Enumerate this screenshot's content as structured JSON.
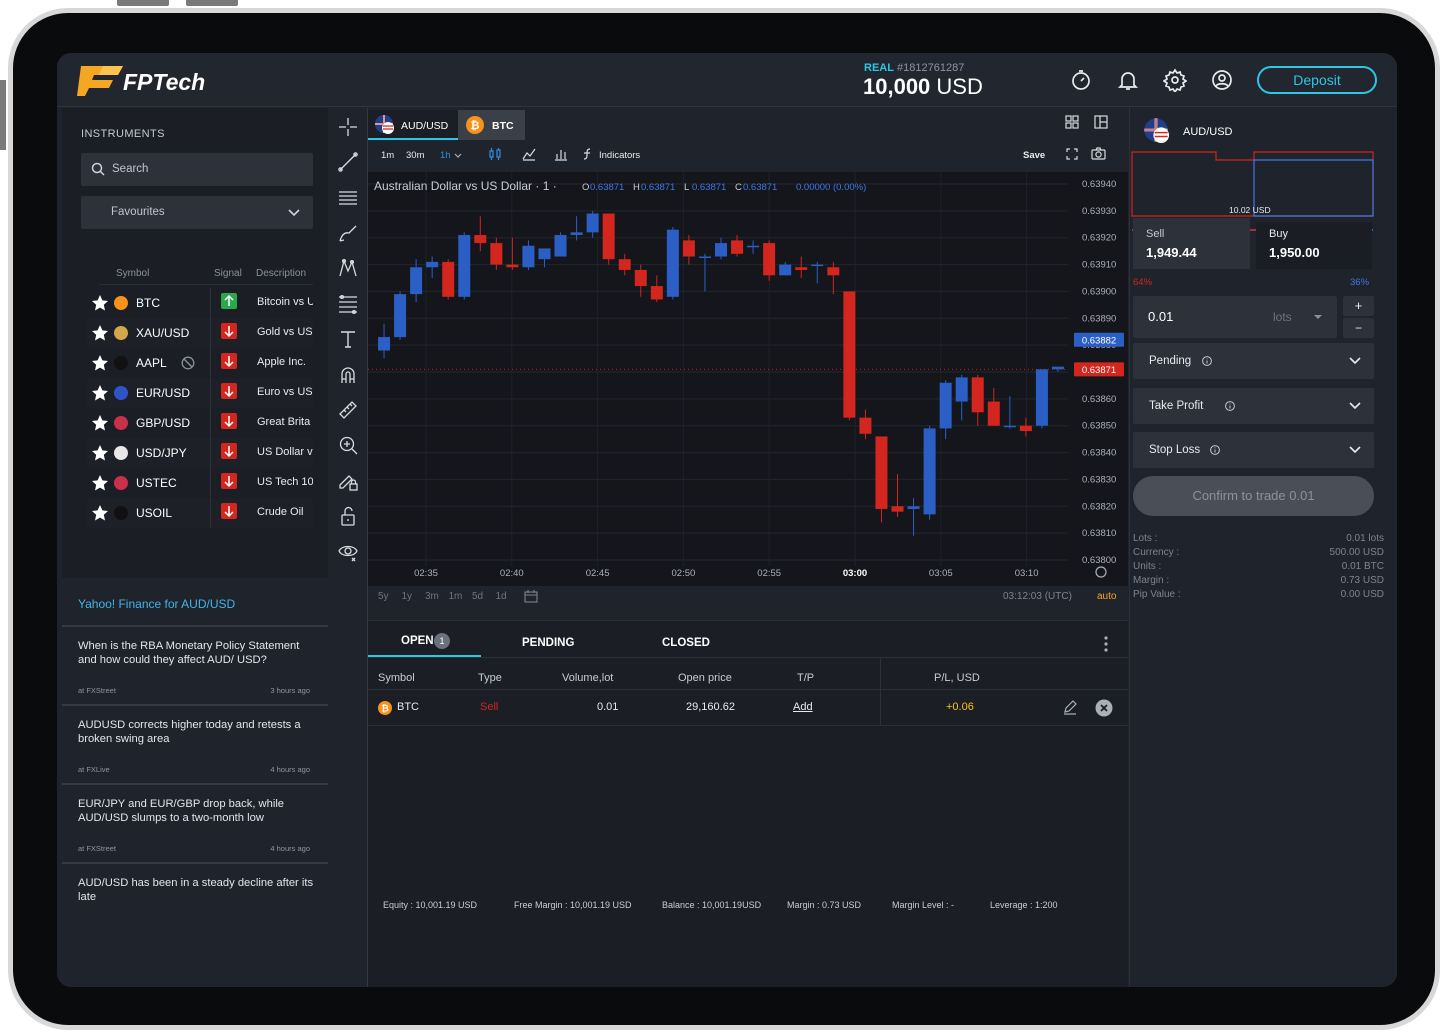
{
  "brand": {
    "logo_letter": "F",
    "name": "FPTech"
  },
  "account": {
    "type": "REAL",
    "number": "#1812761287",
    "balance": "10,000",
    "currency": "USD"
  },
  "topbar": {
    "deposit_label": "Deposit"
  },
  "instruments": {
    "title": "INSTRUMENTS",
    "search_placeholder": "Search",
    "filter": "Favourites",
    "columns": {
      "symbol": "Symbol",
      "signal": "Signal",
      "description": "Description"
    },
    "rows": [
      {
        "symbol": "BTC",
        "signal": "up",
        "description": "Bitcoin vs U",
        "coin_color": "#f7931a"
      },
      {
        "symbol": "XAU/USD",
        "signal": "down",
        "description": "Gold vs US",
        "coin_color": "#d4a84a"
      },
      {
        "symbol": "AAPL",
        "signal": "down",
        "description": "Apple Inc.",
        "coin_color": "#111111"
      },
      {
        "symbol": "EUR/USD",
        "signal": "down",
        "description": "Euro vs US",
        "coin_color": "#2e55c8"
      },
      {
        "symbol": "GBP/USD",
        "signal": "down",
        "description": "Great Brita",
        "coin_color": "#c9304a"
      },
      {
        "symbol": "USD/JPY",
        "signal": "down",
        "description": "US Dollar v",
        "coin_color": "#e8e8e8"
      },
      {
        "symbol": "USTEC",
        "signal": "down",
        "description": "US Tech 10",
        "coin_color": "#c9304a"
      },
      {
        "symbol": "USOIL",
        "signal": "down",
        "description": "Crude Oil",
        "coin_color": "#111111"
      }
    ]
  },
  "news": {
    "title": "Yahoo! Finance for AUD/USD",
    "items": [
      {
        "text": "When is the RBA Monetary Policy Statement and how could they affect AUD/ USD?",
        "source": "at FXStreet",
        "ago": "3 hours ago"
      },
      {
        "text": "AUDUSD corrects higher today and retests a broken swing area",
        "source": "at FXLive",
        "ago": "4 hours ago"
      },
      {
        "text": "EUR/JPY and EUR/GBP drop back, while AUD/USD slumps to a two-month low",
        "source": "at FXStreet",
        "ago": "4 hours ago"
      },
      {
        "text": "AUD/USD has been in a steady decline after its late",
        "source": "",
        "ago": ""
      }
    ]
  },
  "chart_tabs": [
    {
      "label": "AUD/USD"
    },
    {
      "label": "BTC"
    }
  ],
  "chart_toolbar": {
    "intervals": [
      "1m",
      "30m",
      "1h"
    ],
    "indicators_label": "Indicators",
    "save_label": "Save"
  },
  "chart_footer": {
    "ranges": [
      "5y",
      "1y",
      "3m",
      "1m",
      "5d",
      "1d"
    ],
    "clock": "03:12:03 (UTC)",
    "auto_label": "auto"
  },
  "chart_data": {
    "type": "candlestick",
    "title": "Australian Dollar vs US Dollar · 1 ·",
    "ohlc_readout": {
      "O": "0.63871",
      "H": "0.63871",
      "L": "0.63871",
      "C": "0.63871",
      "change": "0.00000 (0.00%)"
    },
    "y_ticks": [
      "0.63940",
      "0.63930",
      "0.63920",
      "0.63910",
      "0.63900",
      "0.63890",
      "0.63880",
      "0.63870",
      "0.63860",
      "0.63850",
      "0.63840",
      "0.63830",
      "0.63820",
      "0.63810",
      "0.63800"
    ],
    "ylim": [
      0.638,
      0.6394
    ],
    "x_ticks": [
      "02:35",
      "02:40",
      "02:45",
      "02:50",
      "02:55",
      "03:00",
      "03:05",
      "03:10"
    ],
    "x_ticks_bold": "03:00",
    "price_labels": [
      {
        "value": "0.63882",
        "color": "#2b5fc6"
      },
      {
        "value": "0.63871",
        "color": "#d2261f"
      }
    ],
    "candles": [
      {
        "o": 0.63878,
        "h": 0.63888,
        "l": 0.63875,
        "c": 0.63883
      },
      {
        "o": 0.63883,
        "h": 0.639,
        "l": 0.63882,
        "c": 0.63899
      },
      {
        "o": 0.63899,
        "h": 0.63912,
        "l": 0.63896,
        "c": 0.63909
      },
      {
        "o": 0.63909,
        "h": 0.63913,
        "l": 0.63905,
        "c": 0.63911
      },
      {
        "o": 0.63911,
        "h": 0.63912,
        "l": 0.63897,
        "c": 0.63898
      },
      {
        "o": 0.63898,
        "h": 0.63922,
        "l": 0.63897,
        "c": 0.63921
      },
      {
        "o": 0.63921,
        "h": 0.63928,
        "l": 0.63915,
        "c": 0.63918
      },
      {
        "o": 0.63918,
        "h": 0.6392,
        "l": 0.63908,
        "c": 0.6391
      },
      {
        "o": 0.6391,
        "h": 0.6392,
        "l": 0.63908,
        "c": 0.63909
      },
      {
        "o": 0.63909,
        "h": 0.63919,
        "l": 0.63908,
        "c": 0.63917
      },
      {
        "o": 0.63912,
        "h": 0.63916,
        "l": 0.63909,
        "c": 0.63916
      },
      {
        "o": 0.63913,
        "h": 0.63922,
        "l": 0.63913,
        "c": 0.63921
      },
      {
        "o": 0.63921,
        "h": 0.63928,
        "l": 0.63919,
        "c": 0.63922
      },
      {
        "o": 0.63922,
        "h": 0.6393,
        "l": 0.6392,
        "c": 0.63929
      },
      {
        "o": 0.63929,
        "h": 0.63929,
        "l": 0.6391,
        "c": 0.63912
      },
      {
        "o": 0.63912,
        "h": 0.63914,
        "l": 0.63906,
        "c": 0.63908
      },
      {
        "o": 0.63908,
        "h": 0.6391,
        "l": 0.63898,
        "c": 0.63902
      },
      {
        "o": 0.63902,
        "h": 0.63906,
        "l": 0.63896,
        "c": 0.63897
      },
      {
        "o": 0.63898,
        "h": 0.63924,
        "l": 0.63897,
        "c": 0.63923
      },
      {
        "o": 0.63919,
        "h": 0.63921,
        "l": 0.6391,
        "c": 0.63913
      },
      {
        "o": 0.63913,
        "h": 0.63914,
        "l": 0.639,
        "c": 0.63913
      },
      {
        "o": 0.63913,
        "h": 0.6392,
        "l": 0.63912,
        "c": 0.63918
      },
      {
        "o": 0.63919,
        "h": 0.63921,
        "l": 0.63913,
        "c": 0.63914
      },
      {
        "o": 0.63917,
        "h": 0.63919,
        "l": 0.63914,
        "c": 0.63917
      },
      {
        "o": 0.63918,
        "h": 0.63919,
        "l": 0.63904,
        "c": 0.63906
      },
      {
        "o": 0.63906,
        "h": 0.63911,
        "l": 0.63906,
        "c": 0.6391
      },
      {
        "o": 0.63909,
        "h": 0.63913,
        "l": 0.63905,
        "c": 0.63908
      },
      {
        "o": 0.6391,
        "h": 0.63911,
        "l": 0.63903,
        "c": 0.6391
      },
      {
        "o": 0.63909,
        "h": 0.63911,
        "l": 0.63899,
        "c": 0.63906
      },
      {
        "o": 0.639,
        "h": 0.639,
        "l": 0.63852,
        "c": 0.63853
      },
      {
        "o": 0.63853,
        "h": 0.63856,
        "l": 0.63845,
        "c": 0.63847
      },
      {
        "o": 0.63846,
        "h": 0.63846,
        "l": 0.63814,
        "c": 0.63819
      },
      {
        "o": 0.6382,
        "h": 0.63832,
        "l": 0.63816,
        "c": 0.63818
      },
      {
        "o": 0.63819,
        "h": 0.63823,
        "l": 0.63809,
        "c": 0.6382
      },
      {
        "o": 0.63817,
        "h": 0.6385,
        "l": 0.63815,
        "c": 0.63849
      },
      {
        "o": 0.63849,
        "h": 0.63867,
        "l": 0.63845,
        "c": 0.63866
      },
      {
        "o": 0.63859,
        "h": 0.63869,
        "l": 0.63852,
        "c": 0.63868
      },
      {
        "o": 0.63868,
        "h": 0.63869,
        "l": 0.6385,
        "c": 0.63855
      },
      {
        "o": 0.63859,
        "h": 0.63864,
        "l": 0.6385,
        "c": 0.6385
      },
      {
        "o": 0.6385,
        "h": 0.63861,
        "l": 0.63849,
        "c": 0.6385
      },
      {
        "o": 0.6385,
        "h": 0.63853,
        "l": 0.63846,
        "c": 0.63848
      },
      {
        "o": 0.6385,
        "h": 0.63871,
        "l": 0.63849,
        "c": 0.63871
      },
      {
        "o": 0.63871,
        "h": 0.63872,
        "l": 0.6387,
        "c": 0.63872
      }
    ]
  },
  "positions": {
    "tabs": [
      {
        "label": "OPEN",
        "count": "1"
      },
      {
        "label": "PENDING"
      },
      {
        "label": "CLOSED"
      }
    ],
    "columns": [
      "Symbol",
      "Type",
      "Volume,lot",
      "Open price",
      "T/P",
      "P/L, USD"
    ],
    "rows": [
      {
        "symbol": "BTC",
        "type": "Sell",
        "volume": "0.01",
        "open_price": "29,160.62",
        "tp": "Add",
        "pl": "+0.06"
      }
    ],
    "footer": {
      "equity": "Equity : 10,001.19 USD",
      "free_margin": "Free Margin : 10,001.19 USD",
      "balance": "Balance : 10,001.19USD",
      "margin": "Margin : 0.73 USD",
      "margin_level": "Margin Level : -",
      "leverage": "Leverage : 1:200"
    }
  },
  "order": {
    "instrument": "AUD/USD",
    "spread": "10.02 USD",
    "sell_label": "Sell",
    "sell_price": "1,949.44",
    "buy_label": "Buy",
    "buy_price": "1,950.00",
    "sell_pct": "64%",
    "buy_pct": "36%",
    "sentiment_sell": 0.64,
    "volume": "0.01",
    "unit": "lots",
    "plus": "+",
    "minus": "−",
    "pending_label": "Pending",
    "take_profit_label": "Take Profit",
    "stop_loss_label": "Stop Loss",
    "confirm_label": "Confirm to trade 0.01",
    "details": [
      {
        "label": "Lots :",
        "value": "0.01 lots"
      },
      {
        "label": "Currency :",
        "value": "500.00 USD"
      },
      {
        "label": "Units :",
        "value": "0.01 BTC"
      },
      {
        "label": "Margin :",
        "value": "0.73 USD"
      },
      {
        "label": "Pip Value :",
        "value": "0.00 USD"
      }
    ]
  },
  "colors": {
    "accent": "#2ec6e6",
    "up": "#2b5fc6",
    "down": "#d2261f",
    "panel": "#1f232b",
    "chart_bg": "#14161b"
  }
}
